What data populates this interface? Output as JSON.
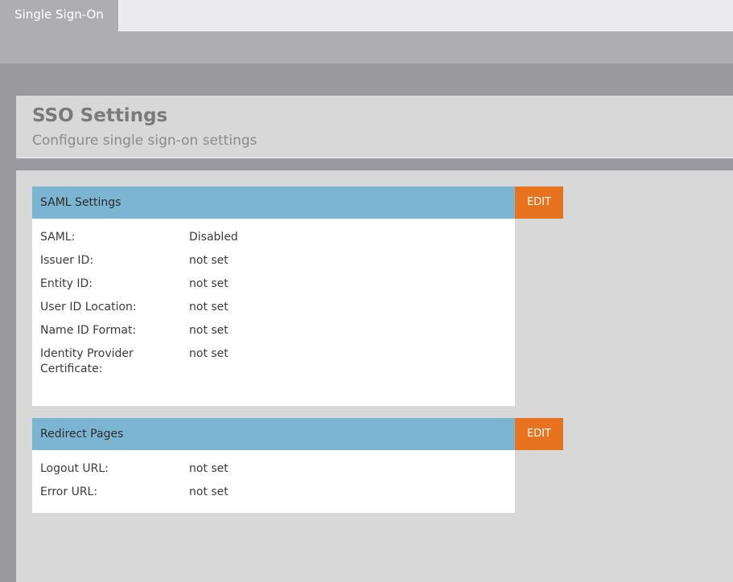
{
  "tabs": {
    "active_label": "Single Sign-On"
  },
  "header": {
    "title": "SSO Settings",
    "subtitle": "Configure single sign-on settings"
  },
  "saml_panel": {
    "title": "SAML Settings",
    "edit_label": "EDIT",
    "rows": [
      {
        "label": "SAML:",
        "value": "Disabled"
      },
      {
        "label": "Issuer ID:",
        "value": "not set"
      },
      {
        "label": "Entity ID:",
        "value": "not set"
      },
      {
        "label": "User ID Location:",
        "value": "not set"
      },
      {
        "label": "Name ID Format:",
        "value": "not set"
      },
      {
        "label": "Identity Provider Certificate:",
        "value": "not set"
      }
    ]
  },
  "redirect_panel": {
    "title": "Redirect Pages",
    "edit_label": "EDIT",
    "rows": [
      {
        "label": "Logout URL:",
        "value": "not set"
      },
      {
        "label": "Error URL:",
        "value": "not set"
      }
    ]
  },
  "colors": {
    "panel_header": "#7bb5d2",
    "edit_button": "#e8731f",
    "tab_active": "#aeadb2"
  }
}
